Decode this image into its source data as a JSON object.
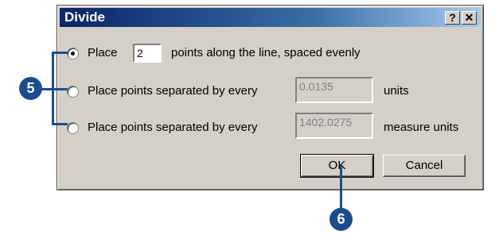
{
  "dialog": {
    "title": "Divide",
    "help_label": "?",
    "close_label": "✕"
  },
  "options": [
    {
      "pre_label": "Place",
      "value": "2",
      "post_label": "points along the line, spaced evenly",
      "checked": true
    },
    {
      "pre_label": "Place points separated by every",
      "value": "0.0135",
      "post_label": "units",
      "checked": false
    },
    {
      "pre_label": "Place points separated by every",
      "value": "1402.0275",
      "post_label": "measure units",
      "checked": false
    }
  ],
  "buttons": {
    "ok_label": "OK",
    "cancel_label": "Cancel"
  },
  "callouts": {
    "step5": "5",
    "step6": "6"
  },
  "colors": {
    "callout": "#1a4d8f",
    "dialog_bg": "#d4d0c8",
    "title_start": "#0a246a"
  }
}
